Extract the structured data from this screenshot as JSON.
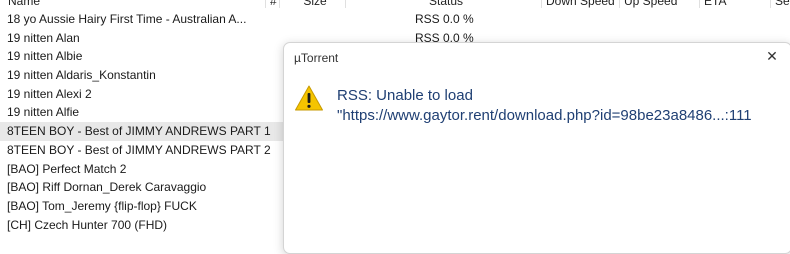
{
  "columns": {
    "name": "Name",
    "number": "#",
    "size": "Size",
    "status": "Status",
    "down_speed": "Down Speed",
    "up_speed": "Up Speed",
    "eta": "ETA",
    "seeds": "Se"
  },
  "rows": [
    {
      "name": "18 yo Aussie Hairy First Time - Australian A...",
      "status": "RSS 0.0 %"
    },
    {
      "name": "19 nitten Alan",
      "status": "RSS 0.0 %"
    },
    {
      "name": "19 nitten Albie",
      "status": ""
    },
    {
      "name": "19 nitten Aldaris_Konstantin",
      "status": ""
    },
    {
      "name": "19 nitten Alexi 2",
      "status": ""
    },
    {
      "name": "19 nitten Alfie",
      "status": ""
    },
    {
      "name": "8TEEN BOY - Best of JIMMY ANDREWS PART 1",
      "status": ""
    },
    {
      "name": "8TEEN BOY - Best of JIMMY ANDREWS PART 2",
      "status": ""
    },
    {
      "name": "[BAO] Perfect Match 2",
      "status": ""
    },
    {
      "name": "[BAO] Riff Dornan_Derek Caravaggio",
      "status": ""
    },
    {
      "name": "[BAO] Tom_Jeremy {flip-flop} FUCK",
      "status": ""
    },
    {
      "name": "[CH] Czech Hunter 700 (FHD)",
      "status": ""
    }
  ],
  "dialog": {
    "title": "µTorrent",
    "close_glyph": "✕",
    "icon": "warning-icon",
    "message_line1": "RSS: Unable to load",
    "message_line2": "\"https://www.gaytor.rent/download.php?id=98be23a8486...:111"
  },
  "colors": {
    "selected_row": "#e8e8e8",
    "message_text": "#1f3f73",
    "warning_fill": "#f5c400"
  }
}
